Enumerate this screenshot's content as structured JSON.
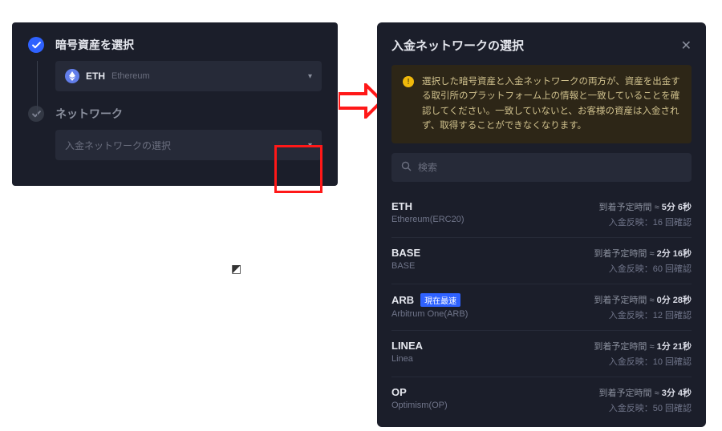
{
  "left": {
    "step1_title": "暗号資産を選択",
    "step2_title": "ネットワーク",
    "selected_coin_symbol": "ETH",
    "selected_coin_name": "Ethereum",
    "network_placeholder": "入金ネットワークの選択"
  },
  "modal": {
    "title": "入金ネットワークの選択",
    "warning": "選択した暗号資産と入金ネットワークの両方が、資産を出金する取引所のプラットフォーム上の情報と一致していることを確認してください。一致していないと、お客様の資産は入金されず、取得することができなくなります。",
    "search_placeholder": "検索",
    "eta_label": "到着予定時間",
    "conf_label": "入金反映：",
    "conf_suffix": " 回確認",
    "fastest_label": "現在最速"
  },
  "networks": [
    {
      "symbol": "ETH",
      "name": "Ethereum(ERC20)",
      "eta": "5分 6秒",
      "confirmations": "16",
      "fastest": false
    },
    {
      "symbol": "BASE",
      "name": "BASE",
      "eta": "2分 16秒",
      "confirmations": "60",
      "fastest": false
    },
    {
      "symbol": "ARB",
      "name": "Arbitrum One(ARB)",
      "eta": "0分 28秒",
      "confirmations": "12",
      "fastest": true
    },
    {
      "symbol": "LINEA",
      "name": "Linea",
      "eta": "1分 21秒",
      "confirmations": "10",
      "fastest": false
    },
    {
      "symbol": "OP",
      "name": "Optimism(OP)",
      "eta": "3分 4秒",
      "confirmations": "50",
      "fastest": false
    }
  ]
}
